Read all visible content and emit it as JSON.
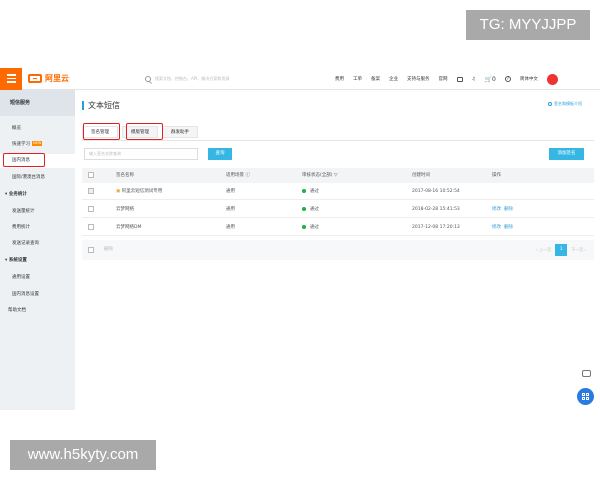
{
  "watermark_top": "TG: MYYJJPP",
  "watermark_bottom": "www.h5kyty.com",
  "header": {
    "logo_text": "阿里云",
    "search_placeholder": "搜索文档、控制台、API、解决方案和资源",
    "nav": [
      "费用",
      "工单",
      "备案",
      "企业",
      "支持与服务",
      "官网"
    ],
    "cart_count": "0",
    "lang": "简体中文"
  },
  "sidebar": {
    "title": "短信服务",
    "items": [
      {
        "label": "概览",
        "group": false
      },
      {
        "label": "快速学习",
        "group": false,
        "badge": "NEW"
      },
      {
        "label": "国内消息",
        "group": false,
        "active": true
      },
      {
        "label": "国际/港澳台消息",
        "group": false
      },
      {
        "label": "业务统计",
        "group": true
      },
      {
        "label": "发送量统计",
        "group": false
      },
      {
        "label": "费用统计",
        "group": false
      },
      {
        "label": "发送记录查询",
        "group": false
      },
      {
        "label": "系统设置",
        "group": true
      },
      {
        "label": "通用设置",
        "group": false
      },
      {
        "label": "国内消息设置",
        "group": false
      },
      {
        "label": "帮助文档",
        "group": false
      }
    ]
  },
  "main": {
    "title": "文本短信",
    "top_link": "签名和模板介绍",
    "tabs": [
      "签名管理",
      "模版管理",
      "群发助手"
    ],
    "search_placeholder": "输入签名名称查询",
    "query_btn": "查询",
    "add_btn": "添加签名"
  },
  "table": {
    "headers": [
      "签名名称",
      "适用场景",
      "审核状态(全部)",
      "创建时间",
      "操作"
    ],
    "rows": [
      {
        "name": "阿里云短信测试专用",
        "scene": "通用",
        "status": "通过",
        "time": "2017-08-16 10:52:54",
        "actions": []
      },
      {
        "name": "云梦网络",
        "scene": "通用",
        "status": "通过",
        "time": "2018-02-28 15:41:53",
        "actions": [
          "修改",
          "删除"
        ]
      },
      {
        "name": "云梦网络DM",
        "scene": "通用",
        "status": "通过",
        "time": "2017-12-08 17:20:13",
        "actions": [
          "修改",
          "删除"
        ]
      }
    ],
    "footer_delete": "删除",
    "pager": {
      "prev": "上一页",
      "current": "1",
      "next": "下一页"
    }
  },
  "colors": {
    "brand": "#ff6a00",
    "accent": "#36b6e3",
    "ok": "#1fad46",
    "highlight": "#e02020"
  }
}
